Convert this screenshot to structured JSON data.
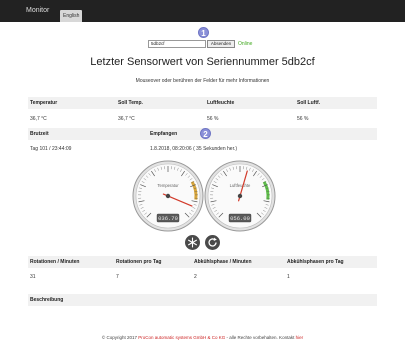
{
  "nav": {
    "brand": "Monitor",
    "language_button": "English"
  },
  "badges": {
    "one": "1",
    "two": "2"
  },
  "serial": {
    "value": "5db2cf",
    "send_label": "Absenden",
    "status": "Online"
  },
  "header": {
    "title": "Letzter Sensorwert von Seriennummer 5db2cf",
    "subtitle": "Mouseover oder berühren der Felder für mehr Informationen"
  },
  "readings": {
    "headers": [
      "Temperatur",
      "Soll Temp.",
      "Luftfeuchte",
      "Soll Luftf."
    ],
    "values": [
      "36,7 °C",
      "36,7 °C",
      "56 %",
      "56 %"
    ]
  },
  "timing": {
    "headers": [
      "Brutzeit",
      "Empfangen"
    ],
    "values": [
      "Tag 101  /  23:44:09",
      "1.8.2018, 08:20:06 ( 35 Sekunden her.)"
    ]
  },
  "gauges": [
    {
      "name": "Temperatur",
      "readout": "036.70",
      "value": 36.7,
      "min": 0,
      "max": 40,
      "accent": "#d9a63a"
    },
    {
      "name": "Luftfeuchte",
      "readout": "056.00",
      "value": 56,
      "min": 0,
      "max": 100,
      "accent": "#5fbf4a"
    }
  ],
  "action_icons": [
    "snowflake-icon",
    "refresh-icon"
  ],
  "counts": {
    "headers": [
      "Rotationen / Minuten",
      "Rotationen pro Tag",
      "Abkühlsphase / Minuten",
      "Abkühlsphasen pro Tag"
    ],
    "values": [
      "31",
      "7",
      "2",
      "1"
    ]
  },
  "description": {
    "header": "Beschreibung"
  },
  "footer": {
    "prefix": "© Copyright 2017",
    "company": "ProCon automatic systems GmbH & Co KG",
    "rights": " - alle Rechte vorbehalten. Kontakt ",
    "contact": "hier"
  },
  "colors": {
    "topbar": "#222222",
    "badge": "#8a90d8",
    "online": "#44aa22",
    "link": "#cc2222",
    "row_bg": "#f1f1f1"
  }
}
